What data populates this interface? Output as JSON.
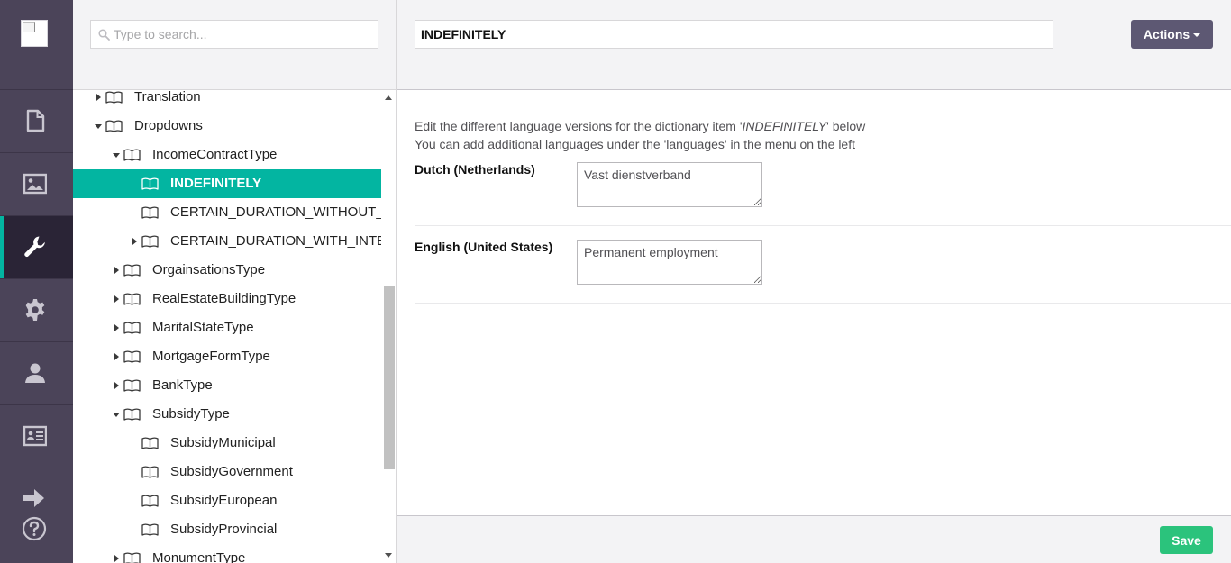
{
  "appbar": {
    "logo": "broken-image-logo",
    "items": [
      {
        "icon": "document-icon",
        "name": "app-content",
        "active": false
      },
      {
        "icon": "image-icon",
        "name": "app-media",
        "active": false
      },
      {
        "icon": "wrench-icon",
        "name": "app-developer",
        "active": true
      },
      {
        "icon": "gear-icon",
        "name": "app-settings",
        "active": false
      },
      {
        "icon": "user-icon",
        "name": "app-users",
        "active": false
      },
      {
        "icon": "id-card-icon",
        "name": "app-members",
        "active": false
      }
    ],
    "bottom": [
      "arrow-right-icon",
      "help-icon"
    ]
  },
  "tree": {
    "search_placeholder": "Type to search...",
    "items": [
      {
        "label": "Translation",
        "caret": "right"
      },
      {
        "label": "Dropdowns",
        "caret": "down"
      },
      {
        "label": "IncomeContractType",
        "caret": "down"
      },
      {
        "label": "INDEFINITELY",
        "caret": "none",
        "selected": true
      },
      {
        "label": "CERTAIN_DURATION_WITHOUT_INTENTION",
        "caret": "none"
      },
      {
        "label": "CERTAIN_DURATION_WITH_INTENTION",
        "caret": "right"
      },
      {
        "label": "OrgainsationsType",
        "caret": "right"
      },
      {
        "label": "RealEstateBuildingType",
        "caret": "right"
      },
      {
        "label": "MaritalStateType",
        "caret": "right"
      },
      {
        "label": "MortgageFormType",
        "caret": "right"
      },
      {
        "label": "BankType",
        "caret": "right"
      },
      {
        "label": "SubsidyType",
        "caret": "down"
      },
      {
        "label": "SubsidyMunicipal",
        "caret": "none"
      },
      {
        "label": "SubsidyGovernment",
        "caret": "none"
      },
      {
        "label": "SubsidyEuropean",
        "caret": "none"
      },
      {
        "label": "SubsidyProvincial",
        "caret": "none"
      },
      {
        "label": "MonumentType",
        "caret": "right"
      }
    ]
  },
  "editor": {
    "item_name": "INDEFINITELY",
    "actions_label": "Actions",
    "intro_line1_prefix": "Edit the different language versions for the dictionary item '",
    "intro_line1_item": "INDEFINITELY",
    "intro_line1_suffix": "' below",
    "intro_line2": "You can add additional languages under the 'languages' in the menu on the left",
    "languages": [
      {
        "label": "Dutch (Netherlands)",
        "value": "Vast dienstverband"
      },
      {
        "label": "English (United States)",
        "value": "Permanent employment"
      }
    ],
    "save_label": "Save"
  },
  "colors": {
    "sidebar_bg": "#4b4459",
    "selected_bg": "#03b5a1",
    "save_bg": "#2bc37c",
    "actions_bg": "#5d5873"
  }
}
